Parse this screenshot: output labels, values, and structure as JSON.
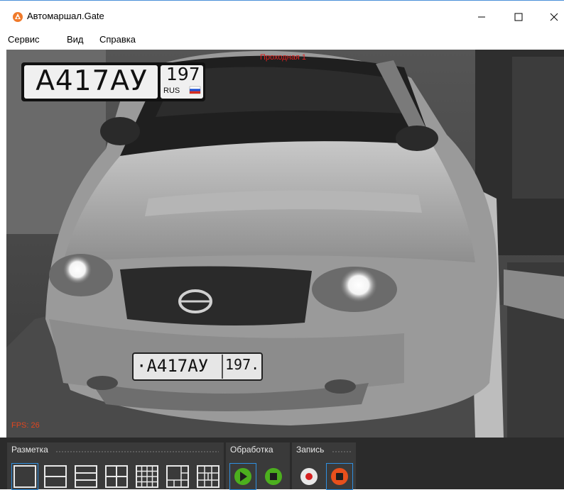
{
  "window": {
    "title": "Автомаршал.Gate"
  },
  "menu": [
    "Сервис",
    "Вид",
    "Справка"
  ],
  "video": {
    "camera_name": "Проходная 1",
    "fps_text": "FPS: 26",
    "plate": {
      "number": "А417АУ",
      "region": "197",
      "country": "RUS"
    },
    "car_plate": {
      "number": "·А417АУ",
      "region": "197."
    }
  },
  "controls": {
    "layout_label": "Разметка",
    "processing_label": "Обработка",
    "record_label": "Запись"
  },
  "colors": {
    "accent": "#2f8fe0",
    "play": "#4caf1e",
    "stop_orange": "#e8501c",
    "overlay_red": "#e02020"
  }
}
